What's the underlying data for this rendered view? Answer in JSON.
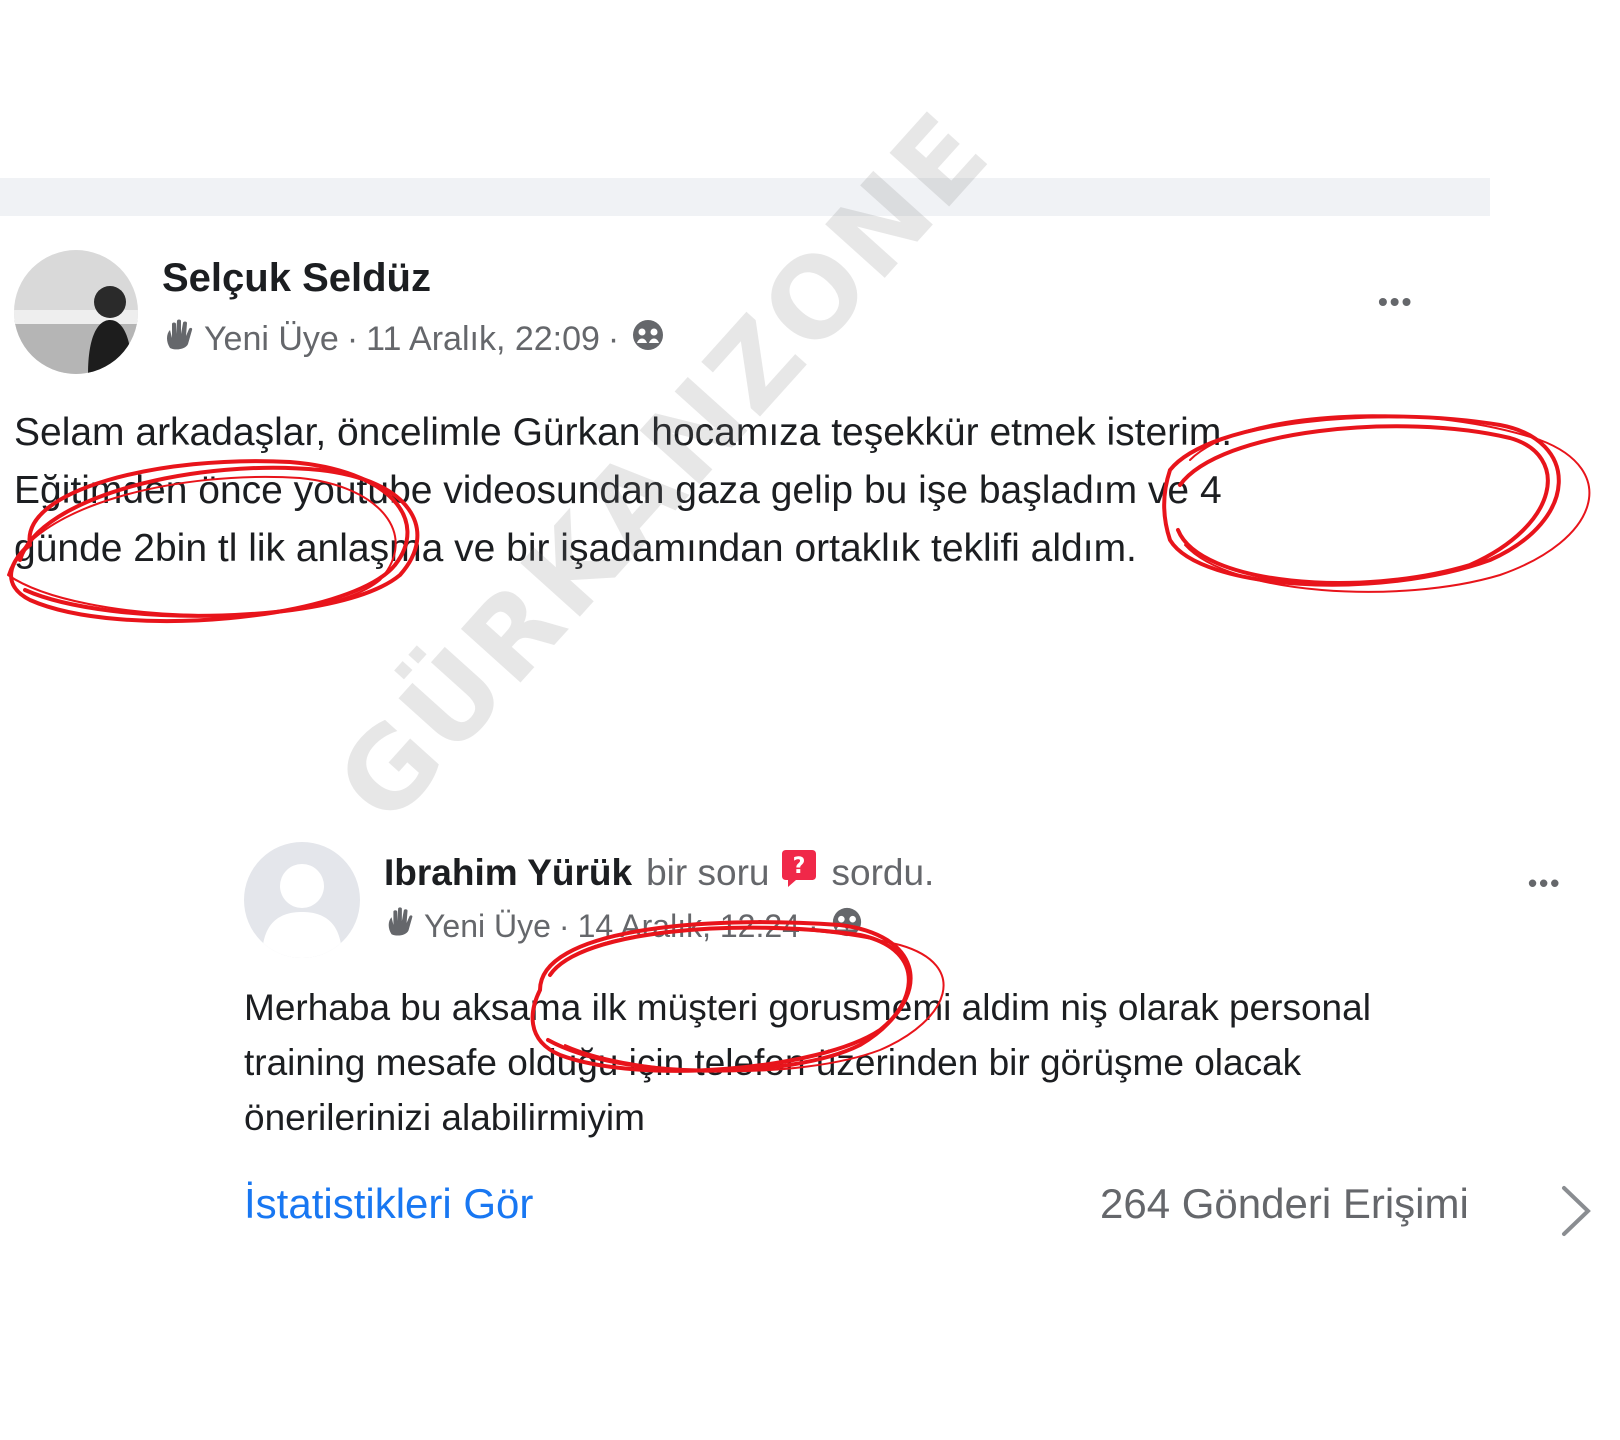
{
  "post1": {
    "author": "Selçuk Seldüz",
    "badge": "Yeni Üye",
    "separator": "·",
    "timestamp": "11 Aralık, 22:09",
    "more": "•••",
    "text_lines": [
      "Selam arkadaşlar, öncelimle Gürkan hocamıza teşekkür etmek isterim.",
      "Eğitimden önce youtube videosundan gaza gelip bu işe başladım ve 4",
      "günde 2bin tl lik anlaşma ve bir işadamından ortaklık teklifi aldım."
    ]
  },
  "post2": {
    "author": "Ibrahim Yürük",
    "action_prefix": "bir soru",
    "action_suffix": "sordu.",
    "badge": "Yeni Üye",
    "separator": "·",
    "timestamp": "14 Aralık, 12:24",
    "more": "•••",
    "text_lines": [
      "Merhaba bu aksama ilk müşteri gorusmemi aldim niş olarak personal",
      "training mesafe olduğu için telefon üzerinden bir görüşme olacak",
      "önerilerinizi alabilirmiyim"
    ],
    "stats_link": "İstatistikleri Gör",
    "reach": "264 Gönderi Erişimi"
  },
  "watermark": "GÜRKANZONE",
  "colors": {
    "link": "#1877f2",
    "highlight_circle": "#e8141b",
    "meta": "#65676b",
    "question_icon": "#f02849"
  }
}
